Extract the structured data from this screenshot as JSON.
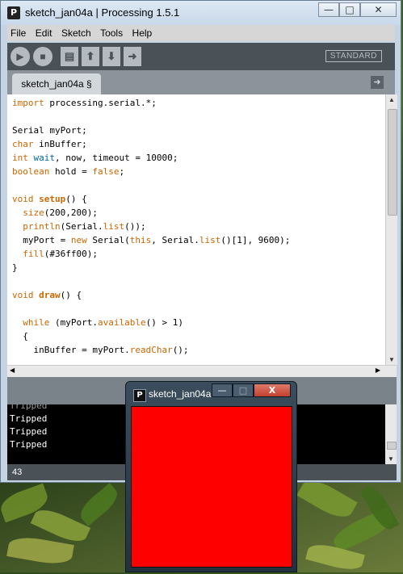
{
  "main_window": {
    "title": "sketch_jan04a | Processing 1.5.1",
    "app_icon_glyph": "P",
    "caption_buttons": {
      "minimize": "—",
      "maximize": "□",
      "close": "✕"
    }
  },
  "menu": [
    "File",
    "Edit",
    "Sketch",
    "Tools",
    "Help"
  ],
  "toolbar": {
    "buttons": [
      {
        "name": "run-button",
        "icon": "play-icon",
        "glyph": "▶"
      },
      {
        "name": "stop-button",
        "icon": "stop-icon",
        "glyph": "■"
      },
      {
        "name": "new-button",
        "icon": "page-icon",
        "glyph": "▤"
      },
      {
        "name": "open-button",
        "icon": "up-arrow-icon",
        "glyph": "⬆"
      },
      {
        "name": "save-button",
        "icon": "down-arrow-icon",
        "glyph": "⬇"
      },
      {
        "name": "export-button",
        "icon": "export-icon",
        "glyph": "➜"
      }
    ],
    "mode": "STANDARD"
  },
  "tabs": [
    {
      "label": "sketch_jan04a §"
    }
  ],
  "code_lines": [
    "import processing.serial.*;",
    "",
    "Serial myPort;",
    "char inBuffer;",
    "int wait, now, timeout = 10000;",
    "boolean hold = false;",
    "",
    "void setup() {",
    "  size(200,200);",
    "  println(Serial.list());",
    "  myPort = new Serial(this, Serial.list()[1], 9600);",
    "  fill(#36ff00);",
    "}",
    "",
    "void draw() {",
    "",
    "  while (myPort.available() > 1)",
    "  {",
    "    inBuffer = myPort.readChar();"
  ],
  "console": {
    "lines": [
      "Tripped",
      "Tripped",
      "Tripped"
    ]
  },
  "footer": {
    "line_number": "43"
  },
  "sketch_window": {
    "title": "sketch_jan04a",
    "icon_glyph": "P",
    "caption_buttons": {
      "minimize": "—",
      "maximize": "□",
      "close": "X"
    },
    "canvas_color": "#ff0000"
  },
  "colors": {
    "toolbar_bg": "#4a5157",
    "keyword": "#cc6600",
    "type_blue": "#006699",
    "console_bg": "#000000"
  }
}
